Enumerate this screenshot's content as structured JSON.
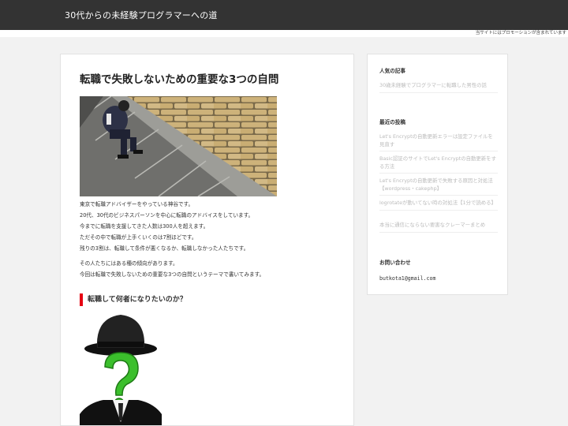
{
  "header": {
    "site_title": "30代からの未経験プログラマーへの道",
    "promo_notice": "当サイトにはプロモーションが含まれています"
  },
  "article": {
    "title": "転職で失敗しないための重要な3つの自問",
    "paragraphs": [
      "東京で転職アドバイザーをやっている神谷です。",
      "20代、30代のビジネスパーソンを中心に転職のアドバイスをしています。",
      "今までに転職を支援してきた人数は300人を超えます。",
      "ただその中で転職が上手くいくのは7割ほどです。",
      "残りの3割は、転職して条件が悪くなるか、転職しなかった人たちです。",
      "その人たちにはある種の傾向があります。",
      "今回は転職で失敗しないための重要な3つの自問というテーマで書いてみます。"
    ],
    "section_heading": "転職して何者になりたいのか？"
  },
  "sidebar": {
    "popular_heading": "人気の記事",
    "popular_items": [
      "30歳未経験でプログラマーに転職した男性の話"
    ],
    "recent_heading": "最近の投稿",
    "recent_items": [
      "Let's Encryptの自動更新エラーは設定ファイルを見直す",
      "Basic認証のサイトでLet's Encryptの自動更新をする方法",
      "Let's Encryptの自動更新で失敗する原因と対処法【wordpress・cakephp】",
      "logrotateが動いてない時の対処法【1分で読める】",
      "本当に通信にならない要害なクレーマーまとめ"
    ],
    "contact_heading": "お問い合わせ",
    "contact_email": "butkota1@gmail.com"
  },
  "colors": {
    "header_bg": "#333333",
    "accent_red": "#e60012",
    "link_gray": "#bbbbbb",
    "page_bg": "#f2f2f2"
  }
}
